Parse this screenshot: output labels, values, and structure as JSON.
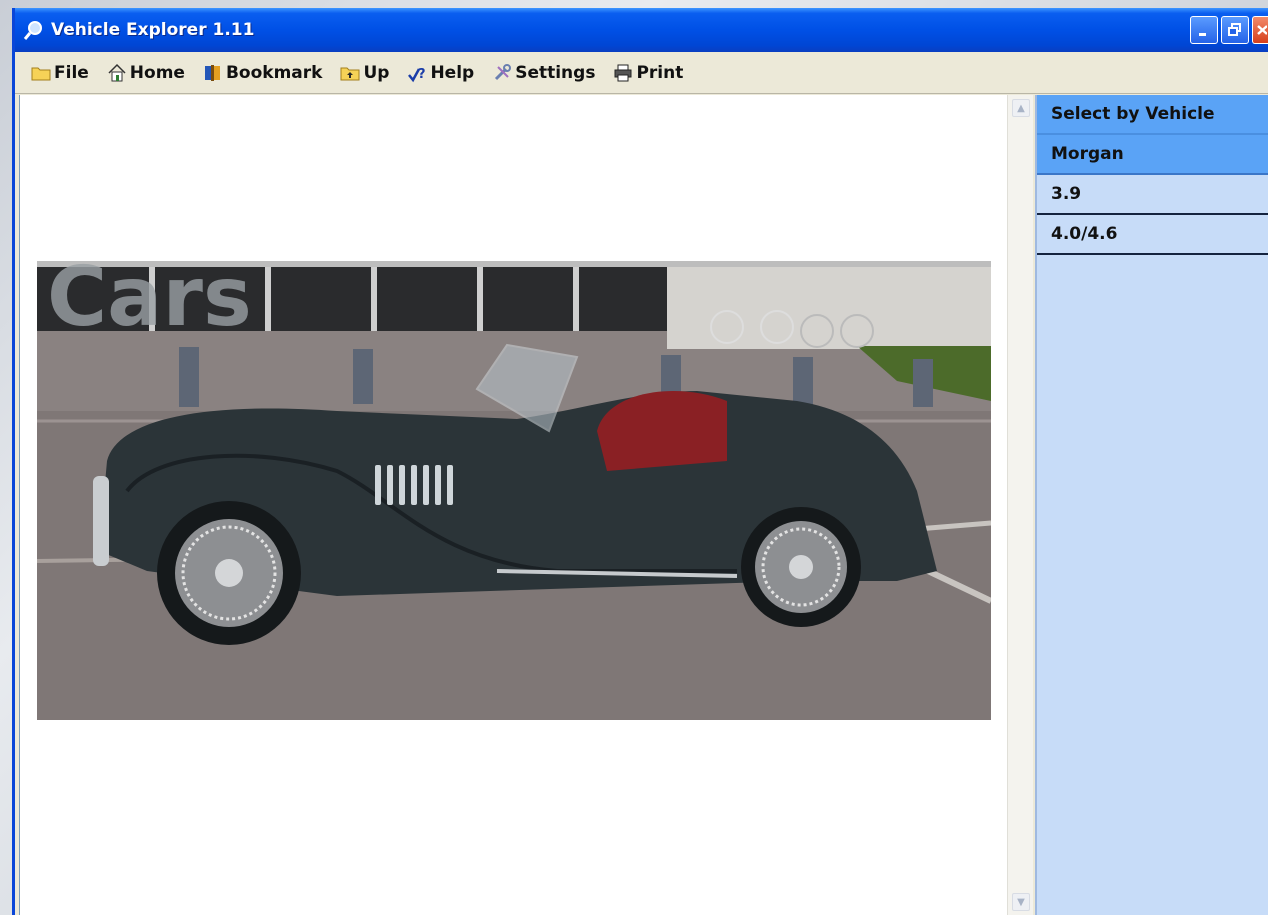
{
  "window": {
    "title": "Vehicle Explorer 1.11"
  },
  "menu": {
    "file": "File",
    "home": "Home",
    "bookmark": "Bookmark",
    "up": "Up",
    "help": "Help",
    "settings": "Settings",
    "print": "Print"
  },
  "panel": {
    "header": "Select by Vehicle",
    "selected_make": "Morgan",
    "items": [
      "3.9",
      "4.0/4.6"
    ]
  },
  "photo_sign": "Cars",
  "colors": {
    "titlebar": "#0050e6",
    "panel_header": "#5aa3f6",
    "panel_bg": "#c7dcf8",
    "car_body": "#2b3438",
    "car_seat": "#8a2024"
  }
}
